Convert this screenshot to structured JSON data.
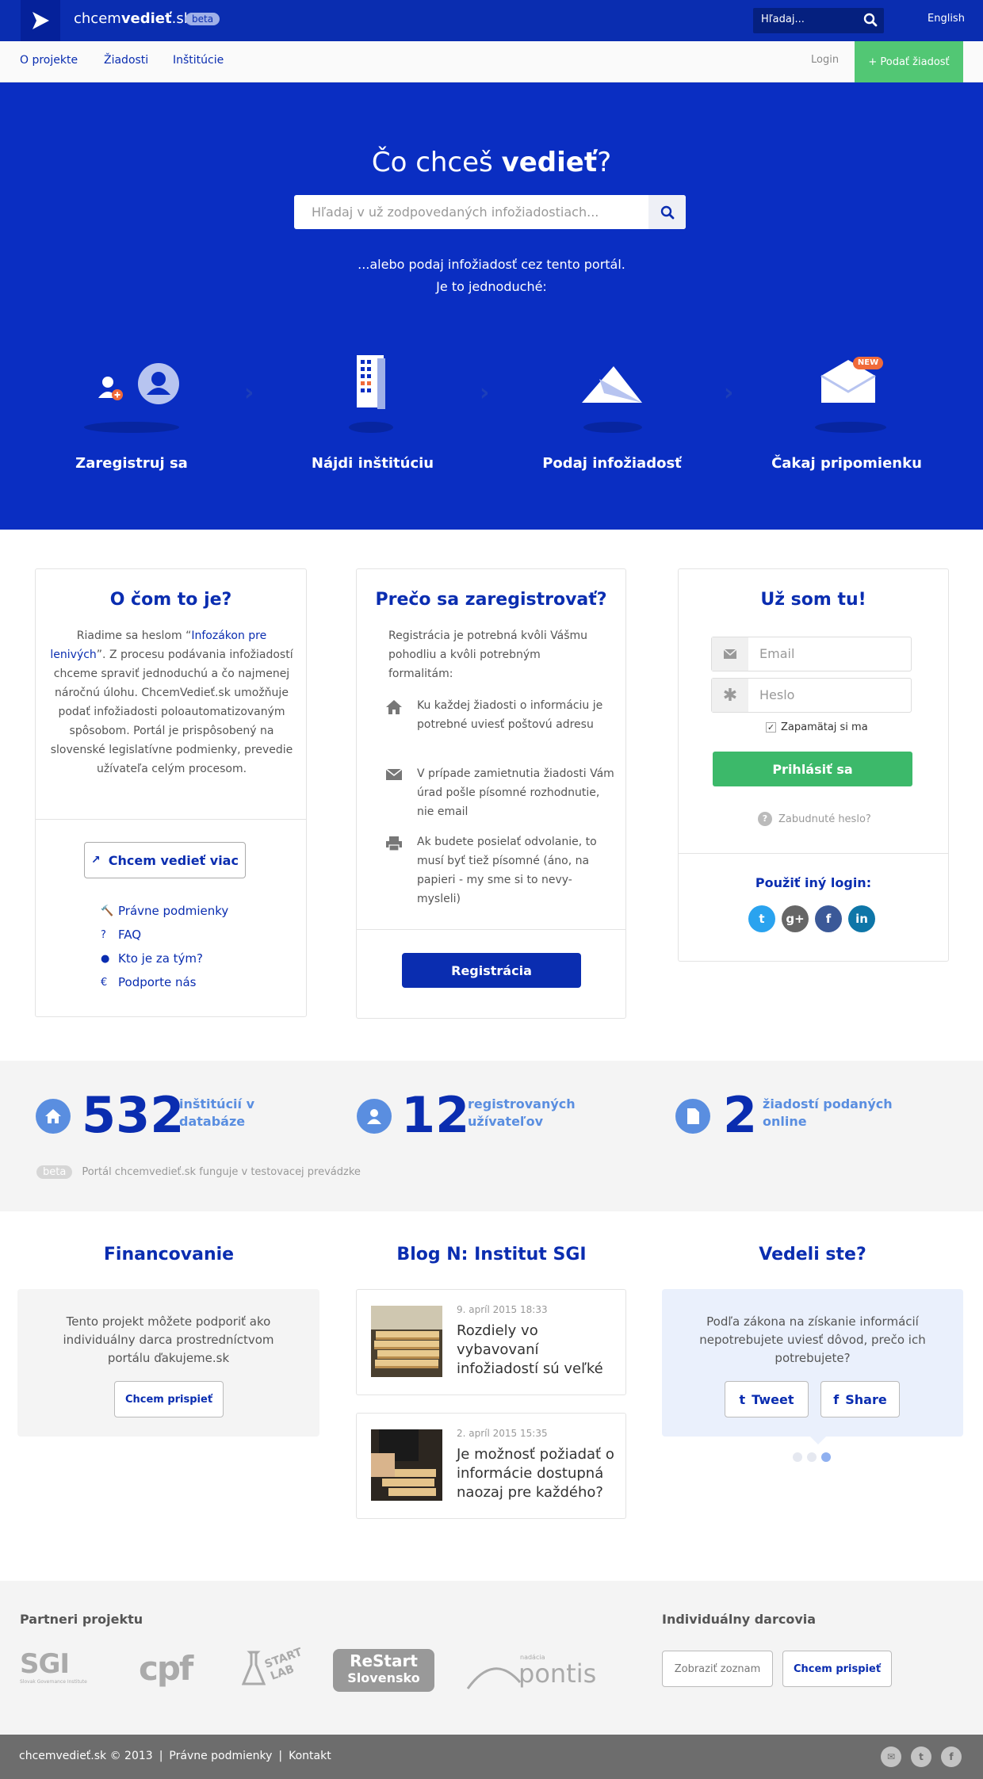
{
  "header": {
    "logo_text_1": "chcem",
    "logo_text_2": "vedieť",
    "logo_text_3": ".sk",
    "beta": "beta",
    "search_placeholder": "Hľadaj...",
    "language": "English"
  },
  "nav": {
    "items": [
      "O projekte",
      "Žiadosti",
      "Inštitúcie"
    ],
    "login": "Login",
    "submit": "+ Podať žiadosť"
  },
  "hero": {
    "title_1": "Čo chceš ",
    "title_2": "vedieť",
    "title_3": "?",
    "search_placeholder": "Hľadaj v už zodpovedaných infožiadostiach...",
    "or_line_1": "...alebo podaj infožiadosť cez tento portál.",
    "or_line_2": "Je to jednoduché:",
    "new_badge": "NEW",
    "steps": [
      "Zaregistruj sa",
      "Nájdi inštitúciu",
      "Podaj infožiadosť",
      "Čakaj pripomienku"
    ]
  },
  "about": {
    "title": "O čom to je?",
    "text_pre": "Riadime sa heslom “",
    "text_link": "Infozákon pre lenivých",
    "text_post": "”. Z procesu podávania infožiadostí chceme spraviť jednoduchú a čo najmenej náročnú úlohu. ChcemVedieť.sk umožňuje podať infožiadosti poloautomatizovaným spôsobom. Portál je prispôsobený na slovenské legislatívne podmienky, prevedie užívateľa celým procesom.",
    "more_button": "Chcem vedieť viac",
    "links": [
      "Právne podmienky",
      "FAQ",
      "Kto je za tým?",
      "Podporte nás"
    ]
  },
  "why": {
    "title": "Prečo sa zaregistrovať?",
    "intro": "Registrácia je potrebná kvôli Vášmu pohodliu a kvôli potrebným formalitám:",
    "reasons": [
      "Ku každej žiadosti o informáciu je potrebné uviesť poštovú adresu",
      "V prípade zamietnutia žiadosti Vám úrad pošle písomné rozhodnutie, nie email",
      "Ak budete posielať odvolanie, to musí byť tiež písomné (áno, na papieri - my sme si to nevy-mysleli)"
    ],
    "register_button": "Registrácia"
  },
  "login": {
    "title": "Už som tu!",
    "email_placeholder": "Email",
    "password_placeholder": "Heslo",
    "remember": "Zapamätaj si ma",
    "submit": "Prihlásiť sa",
    "forgot": "Zabudnuté heslo?",
    "other_login": "Použiť iný login:"
  },
  "stats": [
    {
      "number": "532",
      "label_1": "inštitúcií v",
      "label_2": "databáze"
    },
    {
      "number": "12",
      "label_1": "registrovaných",
      "label_2": "užívateľov"
    },
    {
      "number": "2",
      "label_1": "žiadostí podaných",
      "label_2": "online"
    }
  ],
  "beta_note": {
    "pill": "beta",
    "text": "Portál chcemvedieť.sk funguje v testovacej prevádzke"
  },
  "funding": {
    "title": "Financovanie",
    "text": "Tento projekt môžete podporiť ako individuálny darca prostredníctvom portálu ďakujeme.sk",
    "button": "Chcem prispieť"
  },
  "blog": {
    "title": "Blog N: Institut SGI",
    "posts": [
      {
        "date": "9. apríl 2015 18:33",
        "title": "Rozdiely vo vybavovaní infožiadostí sú veľké"
      },
      {
        "date": "2. apríl 2015 15:35",
        "title": "Je možnosť požiadať o informácie dostupná naozaj pre každého?"
      }
    ]
  },
  "didyouknow": {
    "title": "Vedeli ste?",
    "text": "Podľa zákona na získanie informácií nepotrebujete uviesť dôvod, prečo ich potrebujete?",
    "tweet": "Tweet",
    "share": "Share"
  },
  "partners": {
    "title": "Partneri projektu",
    "logos": [
      "SGI",
      "Slovak Governance Institute",
      "cpf",
      "START",
      "LAB",
      "ReStart",
      "Slovensko",
      "nadácia",
      "pontis"
    ]
  },
  "donors": {
    "title": "Individuálny darcovia",
    "list_button": "Zobraziť zoznam",
    "donate_button": "Chcem prispieť"
  },
  "footer": {
    "brand": "chcemvedieť.sk © 2013",
    "sep": "|",
    "links": [
      "Právne podmienky",
      "Kontakt"
    ]
  },
  "colors": {
    "primary": "#0a2db0",
    "hero": "#0a2ec2",
    "green": "#3cb96a",
    "light_blue": "#5a8ee0"
  }
}
